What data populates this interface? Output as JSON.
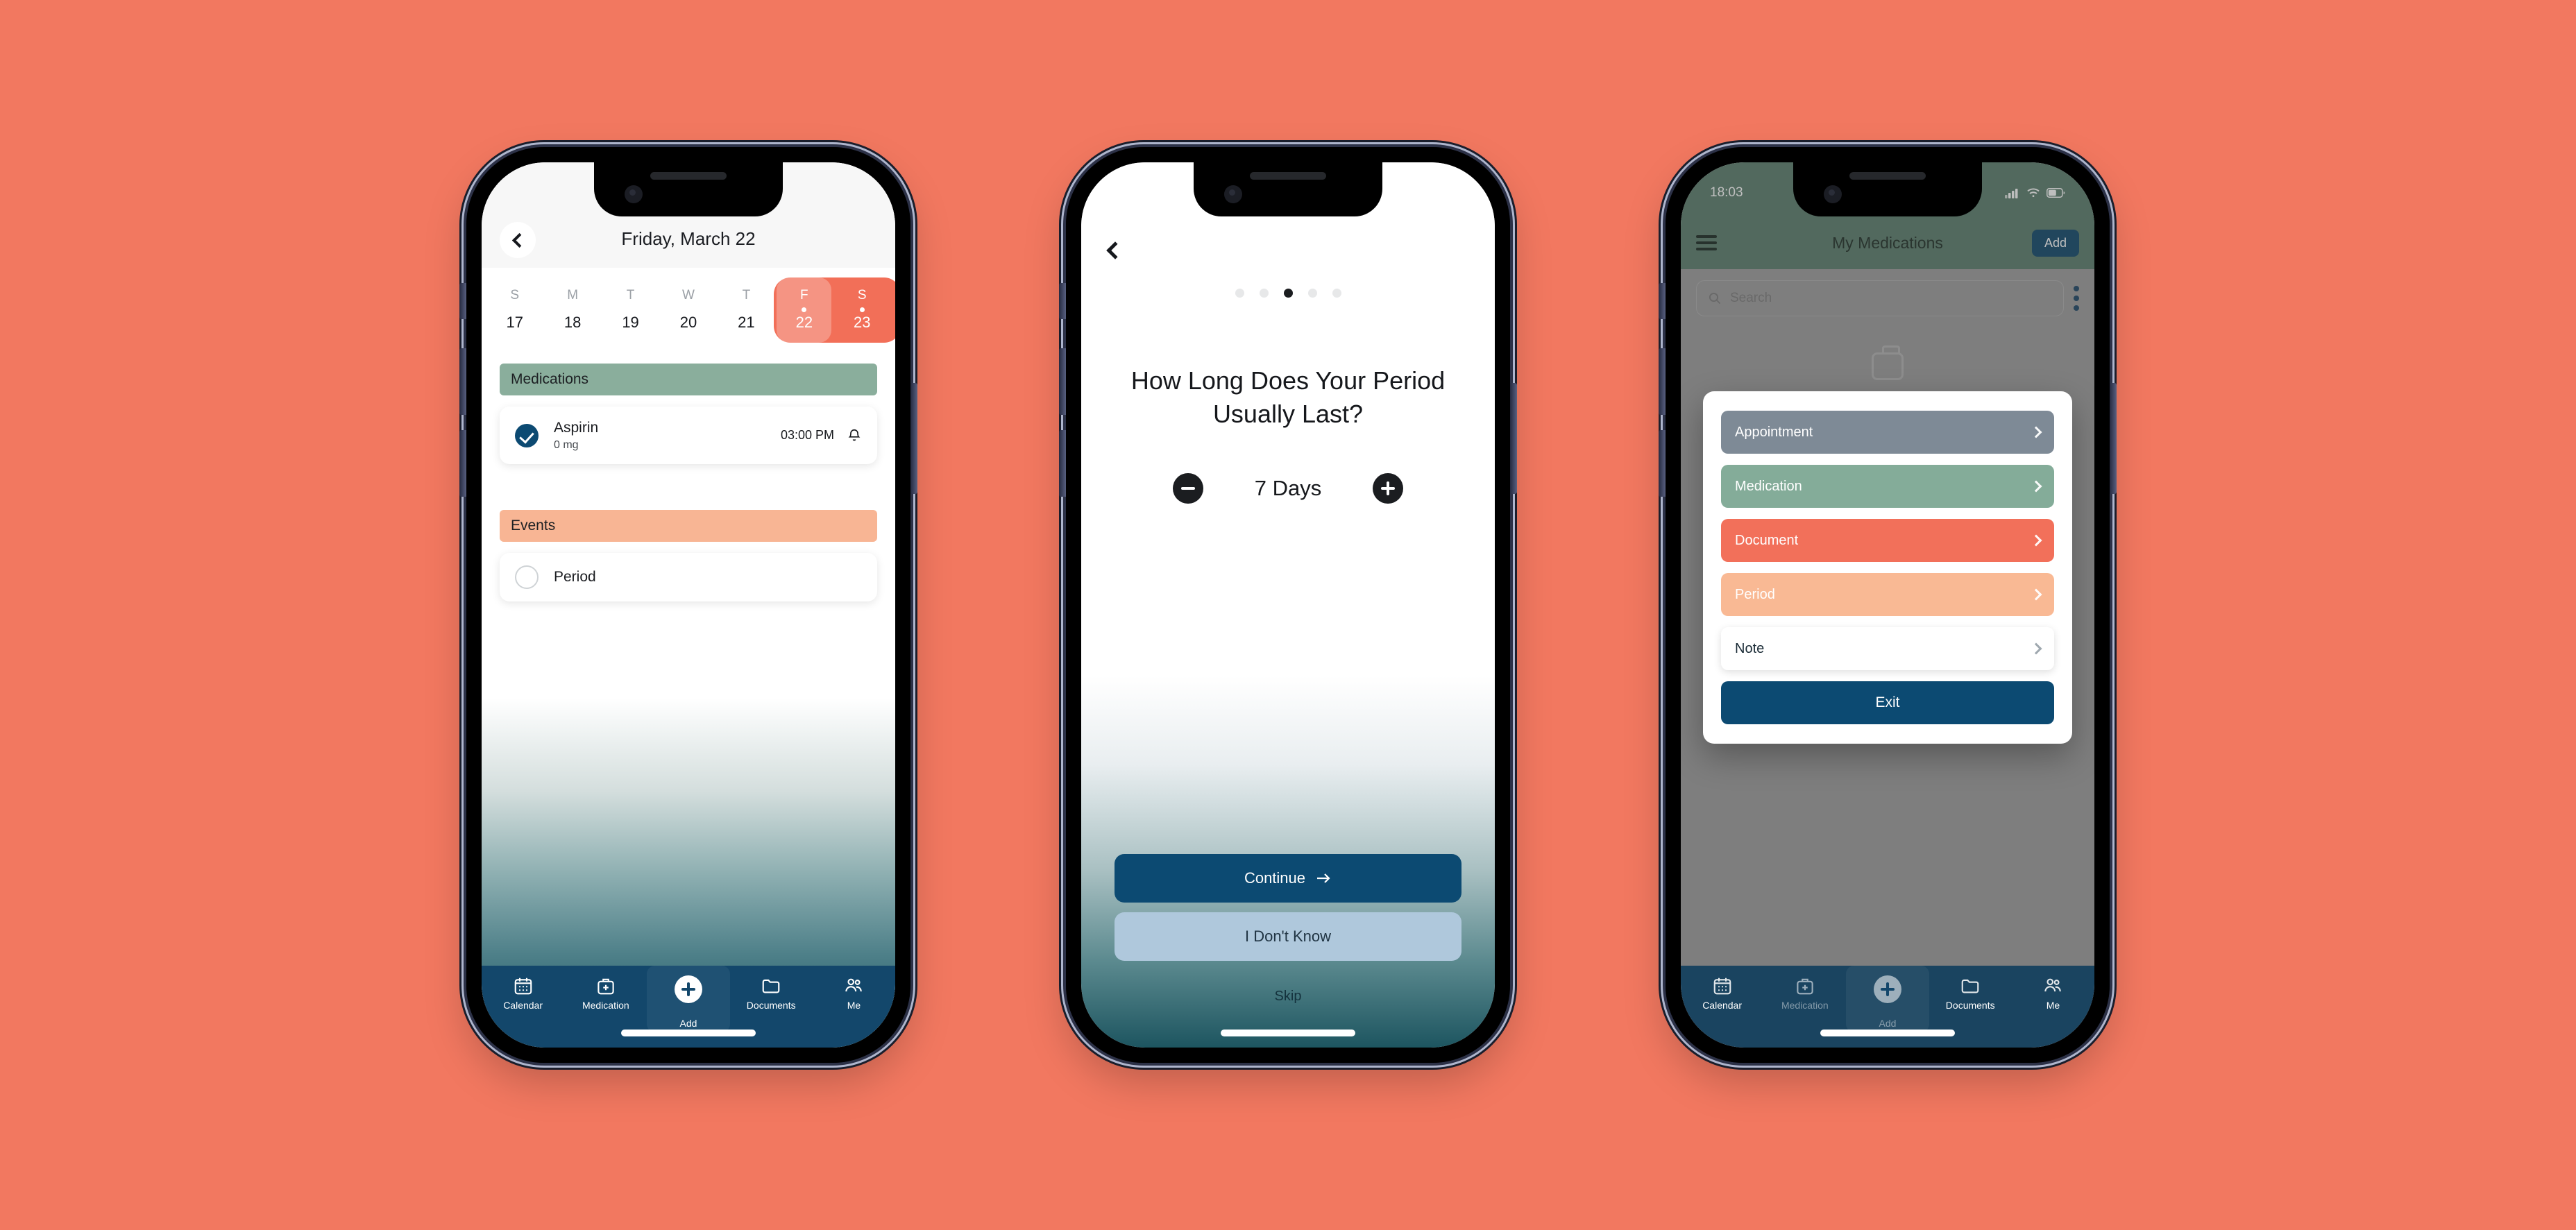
{
  "background_color": "#F27860",
  "phone1": {
    "name": "calendar-day-screen",
    "header": {
      "title": "Friday, March 22",
      "back_icon": "chevron-left-icon"
    },
    "week": [
      {
        "dow": "S",
        "num": "17",
        "highlighted": false,
        "has_dot": false
      },
      {
        "dow": "M",
        "num": "18",
        "highlighted": false,
        "has_dot": false
      },
      {
        "dow": "T",
        "num": "19",
        "highlighted": false,
        "has_dot": false
      },
      {
        "dow": "W",
        "num": "20",
        "highlighted": false,
        "has_dot": false
      },
      {
        "dow": "T",
        "num": "21",
        "highlighted": false,
        "has_dot": false
      },
      {
        "dow": "F",
        "num": "22",
        "highlighted": true,
        "has_dot": true
      },
      {
        "dow": "S",
        "num": "23",
        "highlighted": true,
        "has_dot": true
      }
    ],
    "sections": {
      "medications": {
        "header": "Medications",
        "header_color": "#8AAE9C",
        "items": [
          {
            "name": "Aspirin",
            "dose": "0 mg",
            "time": "03:00 PM",
            "checked": true,
            "bell_icon": "bell-icon"
          }
        ]
      },
      "events": {
        "header": "Events",
        "header_color": "#F8B594",
        "items": [
          {
            "name": "Period",
            "checked": false
          }
        ]
      }
    }
  },
  "phone2": {
    "name": "onboarding-period-length-screen",
    "back_icon": "chevron-left-icon",
    "pagination": {
      "total": 5,
      "active_index": 2
    },
    "question": "How Long Does Your Period Usually Last?",
    "stepper": {
      "minus_icon": "minus-circle-icon",
      "value": "7 Days",
      "plus_icon": "plus-circle-icon"
    },
    "continue_label": "Continue",
    "continue_icon": "arrow-right-icon",
    "dont_know_label": "I Don't Know",
    "skip_label": "Skip",
    "primary_color": "#0C4A72",
    "secondary_color": "#AFC8DC"
  },
  "phone3": {
    "name": "my-medications-add-modal-screen",
    "status_bar": {
      "time": "18:03",
      "signal_icon": "signal-bars-icon",
      "wifi_icon": "wifi-icon",
      "battery_icon": "battery-icon"
    },
    "appbar": {
      "menu_icon": "hamburger-menu-icon",
      "title": "My Medications",
      "add_label": "Add"
    },
    "search": {
      "placeholder": "Search",
      "value": "",
      "search_icon": "search-icon",
      "overflow_icon": "kebab-menu-icon"
    },
    "modal": {
      "options": [
        {
          "label": "Appointment",
          "color": "#7E8A96",
          "chevron_icon": "chevron-right-icon"
        },
        {
          "label": "Medication",
          "color": "#84AC99",
          "chevron_icon": "chevron-right-icon"
        },
        {
          "label": "Document",
          "color": "#F2705A",
          "chevron_icon": "chevron-right-icon"
        },
        {
          "label": "Period",
          "color": "#F9B994",
          "chevron_icon": "chevron-right-icon"
        },
        {
          "label": "Note",
          "color": "#FFFFFF",
          "chevron_icon": "chevron-right-icon"
        }
      ],
      "exit_label": "Exit",
      "exit_color": "#0C4A72"
    }
  },
  "bottom_nav": {
    "items": [
      {
        "label": "Calendar",
        "icon": "calendar-icon"
      },
      {
        "label": "Medication",
        "icon": "medkit-plus-icon"
      },
      {
        "label": "Add",
        "icon": "plus-circle-icon"
      },
      {
        "label": "Documents",
        "icon": "folder-icon"
      },
      {
        "label": "Me",
        "icon": "people-icon"
      }
    ],
    "background_color": "#13476B"
  }
}
